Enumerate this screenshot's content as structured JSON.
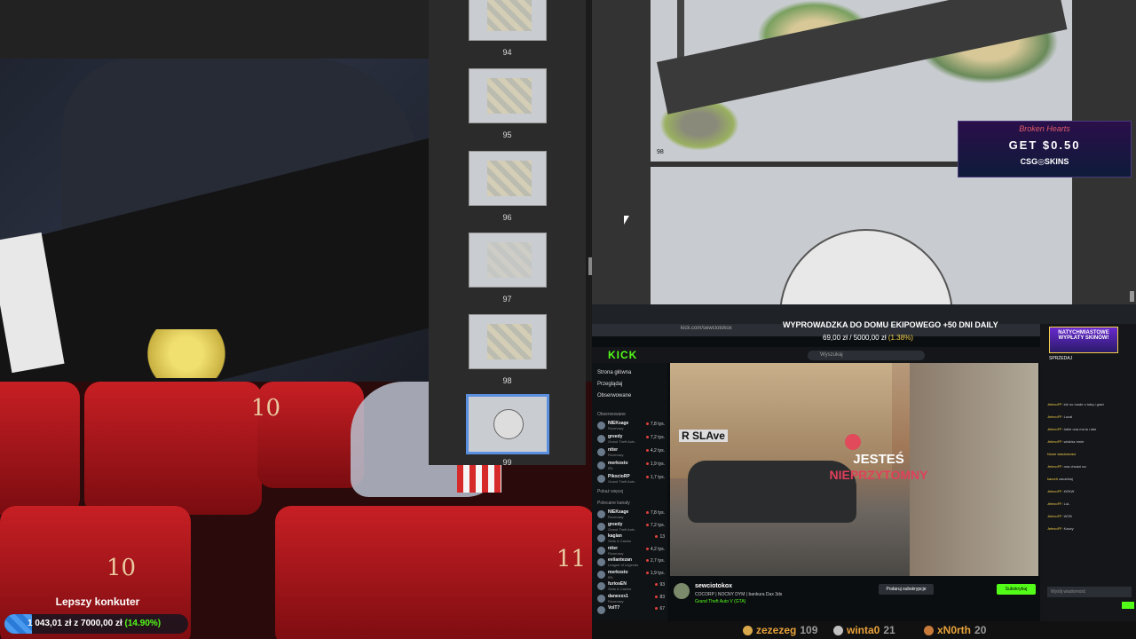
{
  "pdf_viewer": {
    "pages": [
      "94",
      "95",
      "96",
      "97",
      "98",
      "99"
    ],
    "selected_page": "99"
  },
  "manual": {
    "page_label": "98"
  },
  "ad": {
    "top_text": "Broken Hearts",
    "get_text": "GET $0.50",
    "brand": "CSG◎SKINS"
  },
  "kick": {
    "url": "kick.com/sewciotokox",
    "banner_title": "WYPROWADZKA DO DOMU EKIPOWEGO +50 DNI DAILY",
    "banner_progress": "69,00 zł / 5000,00 zł",
    "banner_pct": "(1.38%)",
    "logo": "KICK",
    "search_placeholder": "Wyszukaj",
    "sidebar": {
      "nav": [
        "Strona główna",
        "Przeglądaj",
        "Obserwowane"
      ],
      "followed_header": "Obserwowane",
      "followed": [
        {
          "name": "NIEKsage",
          "cat": "Rozmowy",
          "viewers": "7,8 tys."
        },
        {
          "name": "greedy",
          "cat": "Grand Theft Auto",
          "viewers": "7,2 tys."
        },
        {
          "name": "ntter",
          "cat": "Rozmowy",
          "viewers": "4,2 tys."
        },
        {
          "name": "merkosto",
          "cat": "IRL",
          "viewers": "1,9 tys."
        },
        {
          "name": "PikocioRP",
          "cat": "Grand Theft Auto",
          "viewers": "1,7 tys."
        }
      ],
      "show_more": "Pokaż więcej",
      "recommended_header": "Polecane kanały",
      "recommended": [
        {
          "name": "NIEKsage",
          "cat": "Rozmowy",
          "viewers": "7,8 tys."
        },
        {
          "name": "greedy",
          "cat": "Grand Theft Auto",
          "viewers": "7,2 tys."
        },
        {
          "name": "kagian",
          "cat": "Slots & Casino",
          "viewers": "13"
        },
        {
          "name": "ntter",
          "cat": "Rozmowy",
          "viewers": "4,2 tys."
        },
        {
          "name": "evilantezan",
          "cat": "League of Legends",
          "viewers": "2,7 tys."
        },
        {
          "name": "merkosto",
          "cat": "IRL",
          "viewers": "1,9 tys."
        },
        {
          "name": "furiosEN",
          "cat": "Slots & Casino",
          "viewers": "93"
        },
        {
          "name": "danexxx1",
          "cat": "Rozmowy",
          "viewers": "83"
        },
        {
          "name": "VolT7",
          "cat": "",
          "viewers": "67"
        }
      ]
    },
    "video": {
      "sign": "R SLAve",
      "line1": "JESTEŚ",
      "line2": "NIEPRZYTOMNY"
    },
    "streamer": {
      "name": "sewciotokox",
      "title": "COCORP | NOCNY DYM | bankura Dax 3ds",
      "game": "Grand Theft Auto V (GTA)",
      "subscribe": "Podaruj subskrypcje",
      "follow": "Subskrybuj"
    },
    "chat": {
      "ad_line1": "NATYCHMIASTOWE",
      "ad_line2": "WYPŁATY SKINÓW!",
      "ad_line3": "SPRZEDAJ",
      "input_placeholder": "Wyślij wiadomość",
      "lines": [
        {
          "u": "JelexoFF:",
          "t": "idź no mode z tobą i grad"
        },
        {
          "u": "JelexoFF:",
          "t": "Local"
        },
        {
          "u": "JelexoFF:",
          "t": "tobie ona ma tu robe"
        },
        {
          "u": "JelexoFF:",
          "t": "widzisz mnie"
        },
        {
          "u": "Nowe wiadomości",
          "t": ""
        },
        {
          "u": "JelexoFF:",
          "t": "ona chodzi na"
        },
        {
          "u": "kacorh",
          "t": "zaczekaj"
        },
        {
          "u": "JelexoFF:",
          "t": "KEKW"
        },
        {
          "u": "JelexoFF:",
          "t": "LuL"
        },
        {
          "u": "JelexoFF:",
          "t": "WOK"
        },
        {
          "u": "JelexoFF:",
          "t": "Kaczy"
        }
      ]
    }
  },
  "overlay": {
    "title": "Lepszy konkuter",
    "progress_text": "1 043,01 zł z 7000,00 zł",
    "progress_pct": "(14.90%)",
    "progress_fraction": 0.149
  },
  "leaderboard": [
    {
      "name": "zezezeg",
      "value": "109",
      "color": "#d9a84a"
    },
    {
      "name": "winta0",
      "value": "21",
      "color": "#c0c0c0"
    },
    {
      "name": "xN0rth",
      "value": "20",
      "color": "#c87a3a"
    }
  ]
}
